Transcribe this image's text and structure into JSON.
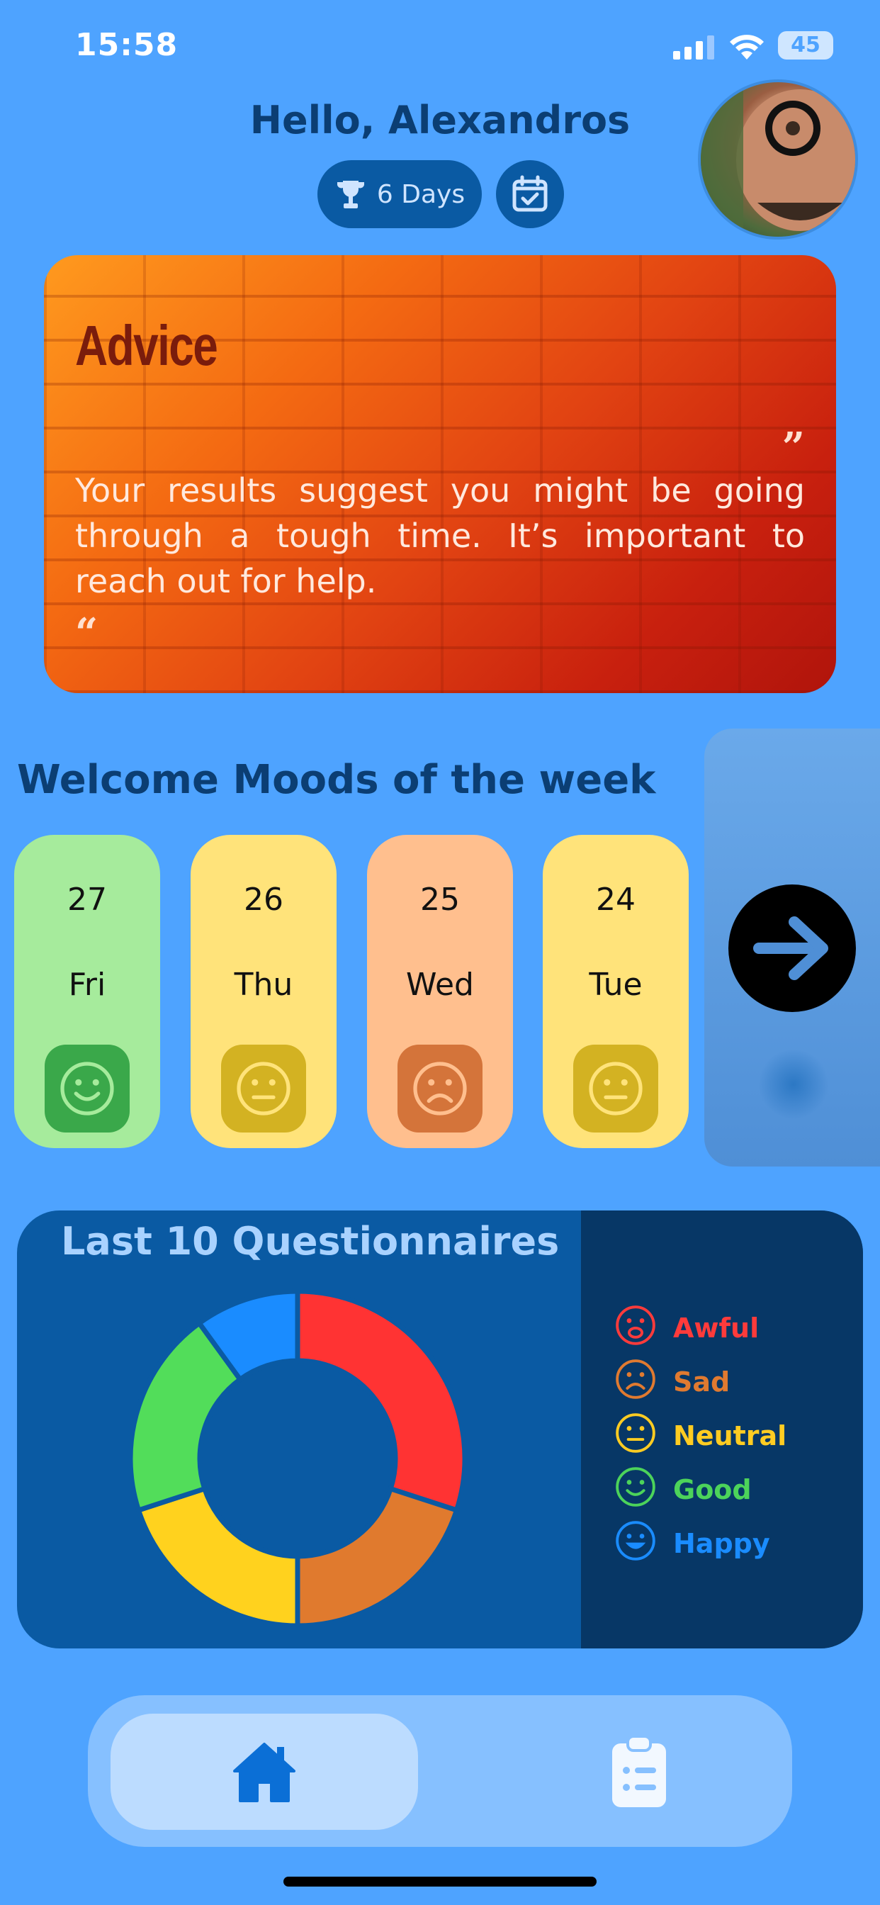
{
  "status_bar": {
    "time": "15:58",
    "battery": "45"
  },
  "header": {
    "greeting": "Hello, Alexandros",
    "streak": "6 Days"
  },
  "advice": {
    "title": "Advice",
    "text": "Your results suggest you might be going through a tough time. It’s important to reach out for help."
  },
  "moods": {
    "title": "Welcome Moods of the week",
    "days": [
      {
        "day": "27",
        "weekday": "Fri",
        "mood": "Good",
        "bg": "#a6eb9c",
        "face_bg": "#3aa84a",
        "face": "smile"
      },
      {
        "day": "26",
        "weekday": "Thu",
        "mood": "Neutral",
        "bg": "#ffe37a",
        "face_bg": "#d3b222",
        "face": "neutral"
      },
      {
        "day": "25",
        "weekday": "Wed",
        "mood": "Sad",
        "bg": "#ffbf8e",
        "face_bg": "#d4743a",
        "face": "sad"
      },
      {
        "day": "24",
        "weekday": "Tue",
        "mood": "Neutral",
        "bg": "#ffe37a",
        "face_bg": "#d3b222",
        "face": "neutral"
      }
    ]
  },
  "questionnaires": {
    "title": "Last 10 Questionnaires",
    "legend": [
      {
        "label": "Awful",
        "color": "#ff3b3b",
        "icon": "awful-face-icon"
      },
      {
        "label": "Sad",
        "color": "#e07a30",
        "icon": "sad-face-icon"
      },
      {
        "label": "Neutral",
        "color": "#ffcc22",
        "icon": "neutral-face-icon"
      },
      {
        "label": "Good",
        "color": "#4cd35a",
        "icon": "good-face-icon"
      },
      {
        "label": "Happy",
        "color": "#1a8cff",
        "icon": "happy-face-icon"
      }
    ]
  },
  "chart_data": {
    "type": "pie",
    "categories": [
      "Awful",
      "Sad",
      "Neutral",
      "Good",
      "Happy"
    ],
    "values": [
      3,
      2,
      2,
      2,
      1
    ],
    "colors": [
      "#ff3333",
      "#e07a2e",
      "#ffd21e",
      "#52dd5a",
      "#1a8cff"
    ]
  },
  "nav": {
    "items": [
      "home-icon",
      "clipboard-list-icon"
    ]
  }
}
